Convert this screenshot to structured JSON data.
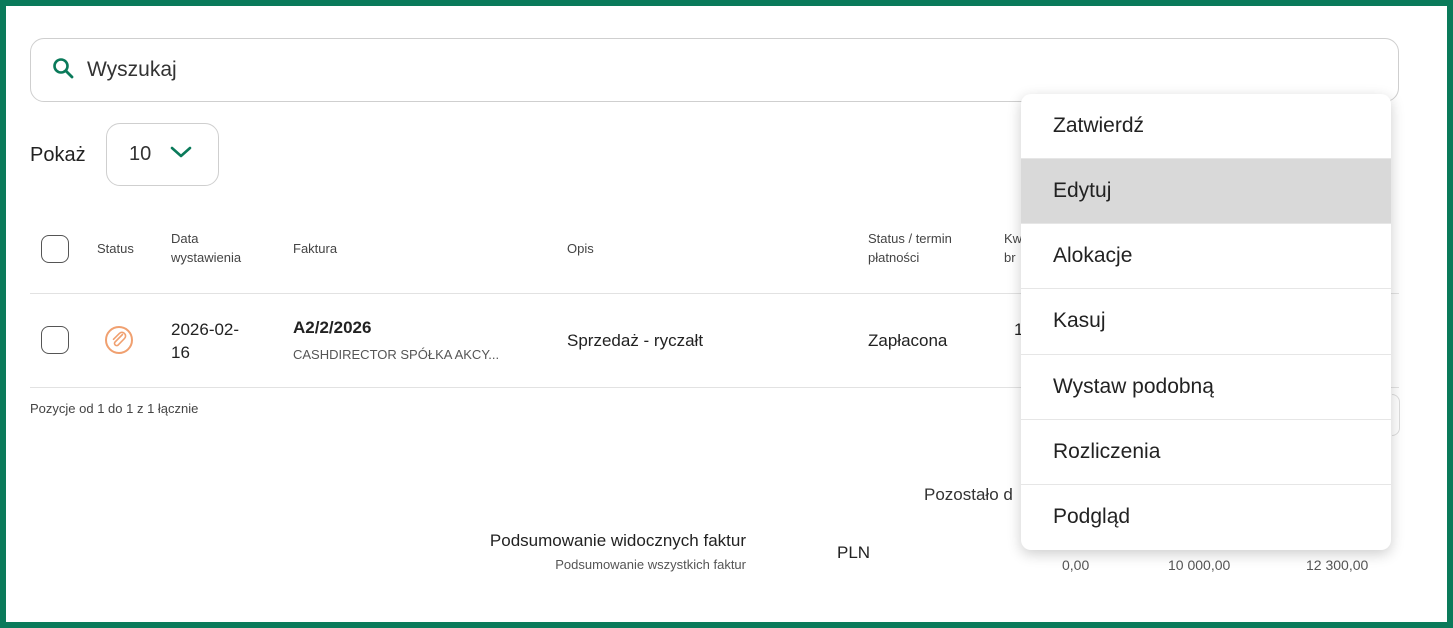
{
  "search": {
    "placeholder": "Wyszukaj",
    "icon": "search-icon"
  },
  "page_size": {
    "label": "Pokaż",
    "value": "10"
  },
  "table": {
    "headers": {
      "status": "Status",
      "issue_date_1": "Data",
      "issue_date_2": "wystawienia",
      "invoice": "Faktura",
      "description": "Opis",
      "payment_status_1": "Status / termin",
      "payment_status_2": "płatności",
      "gross_amount_1": "Kw",
      "gross_amount_2": "br"
    },
    "rows": [
      {
        "date_1": "2026-02-",
        "date_2": "16",
        "invoice_number": "A2/2/2026",
        "customer": "CASHDIRECTOR SPÓŁKA AKCY...",
        "description": "Sprzedaż - ryczałt",
        "payment_status": "Zapłacona",
        "amount_fragment": "1"
      }
    ],
    "footer": "Pozycje od 1 do 1 z 1 łącznie"
  },
  "summary": {
    "remaining_label": "Pozostało d",
    "visible_label": "Podsumowanie widocznych faktur",
    "all_label": "Podsumowanie wszystkich faktur",
    "currency": "PLN",
    "values": [
      "0,00",
      "10 000,00",
      "12 300,00"
    ]
  },
  "context_menu": {
    "items": [
      "Zatwierdź",
      "Edytuj",
      "Alokacje",
      "Kasuj",
      "Wystaw podobną",
      "Rozliczenia",
      "Podgląd"
    ],
    "active": "Edytuj"
  },
  "colors": {
    "frame": "#0a7a5a",
    "accent": "#0a7a5a",
    "status_icon": "#f0a070",
    "menu_active_bg": "#d9d9d9"
  }
}
